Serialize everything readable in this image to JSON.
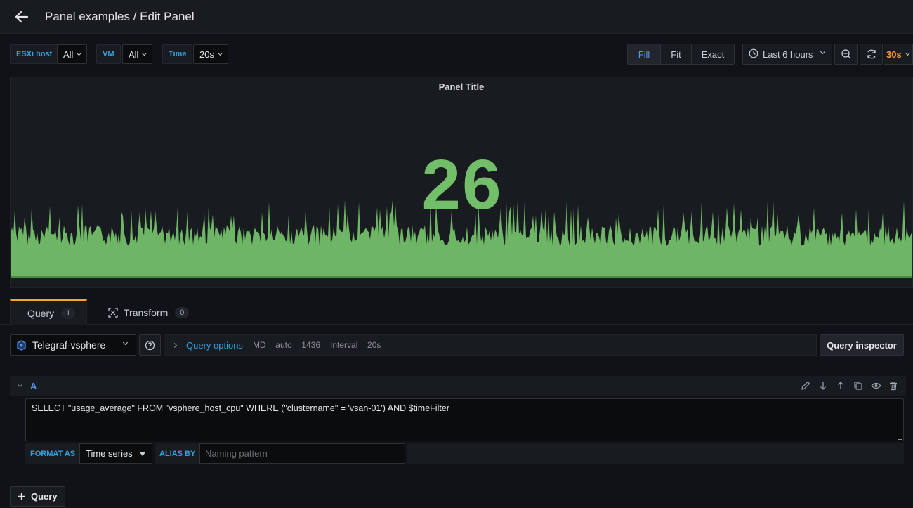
{
  "header": {
    "title": "Panel examples / Edit Panel"
  },
  "variables": [
    {
      "label": "ESXi host",
      "value": "All"
    },
    {
      "label": "VM",
      "value": "All"
    },
    {
      "label": "Time",
      "value": "20s"
    }
  ],
  "display_modes": {
    "options": [
      "Fill",
      "Fit",
      "Exact"
    ],
    "selected": "Fill"
  },
  "time_picker": {
    "range": "Last 6 hours",
    "refresh_interval": "30s"
  },
  "panel": {
    "title": "Panel Title",
    "stat_value": "26",
    "stat_color": "#73bf69"
  },
  "tabs": [
    {
      "label": "Query",
      "count": "1",
      "icon": "database-icon",
      "active": true
    },
    {
      "label": "Transform",
      "count": "0",
      "icon": "transform-icon",
      "active": false
    }
  ],
  "editor": {
    "datasource": "Telegraf-vsphere",
    "query_options": {
      "label": "Query options",
      "md": "MD = auto = 1436",
      "interval": "Interval = 20s"
    },
    "inspector_label": "Query inspector",
    "query": {
      "ref_id": "A",
      "text": "SELECT \"usage_average\" FROM \"vsphere_host_cpu\" WHERE (\"clustername\" = 'vsan-01') AND $timeFilter",
      "format_as_label": "FORMAT AS",
      "format_as_value": "Time series",
      "alias_by_label": "ALIAS BY",
      "alias_placeholder": "Naming pattern"
    },
    "add_query_label": "Query"
  },
  "colors": {
    "accent_blue": "#33a2e5",
    "orange": "#ff9830",
    "green": "#73bf69"
  }
}
